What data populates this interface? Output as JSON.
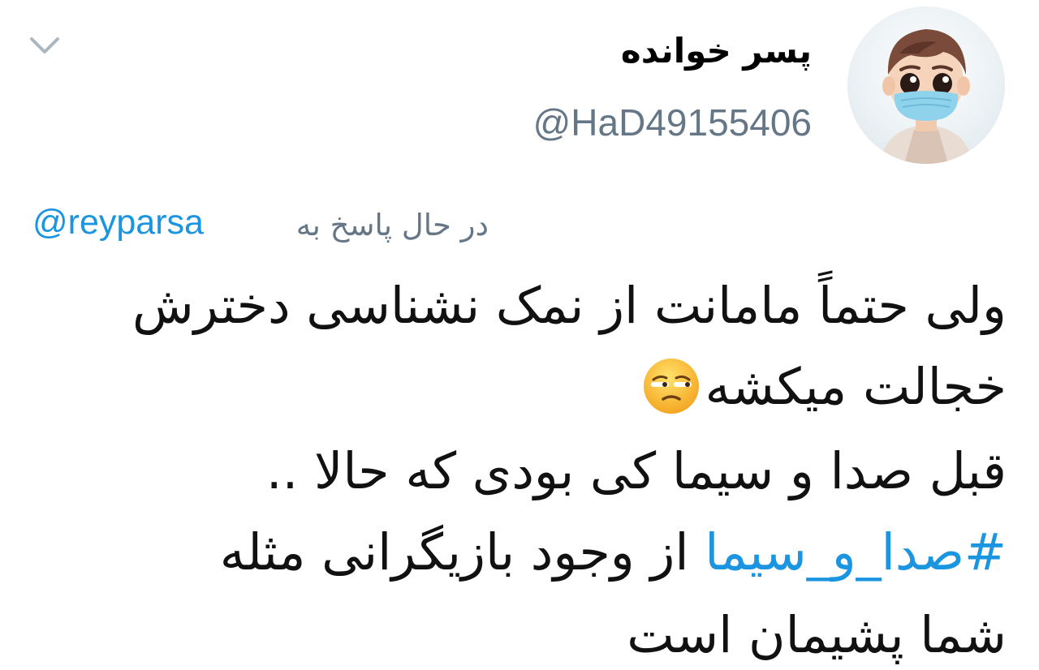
{
  "header": {
    "display_name": "پسر خوانده",
    "handle": "@HaD49155406"
  },
  "reply": {
    "label": "در حال پاسخ به",
    "mention": "@reyparsa"
  },
  "tweet": {
    "line1": "ولی حتماً مامانت از نمک نشناسی دخترش",
    "line2": "خجالت میکشه",
    "line3": "قبل صدا و سیما کی بودی که حالا ..",
    "line4_hashtag": "#صدا_و_سیما",
    "line4_text": " از وجود بازیگرانی مثله",
    "line5": "شما پشیمان است",
    "emoji": "unamused-face-emoji"
  },
  "icons": {
    "menu": "chevron-down-icon",
    "avatar": "cartoon-boy-avatar"
  },
  "colors": {
    "link": "#1b95e0",
    "secondary_text": "#657786",
    "text": "#111111"
  }
}
